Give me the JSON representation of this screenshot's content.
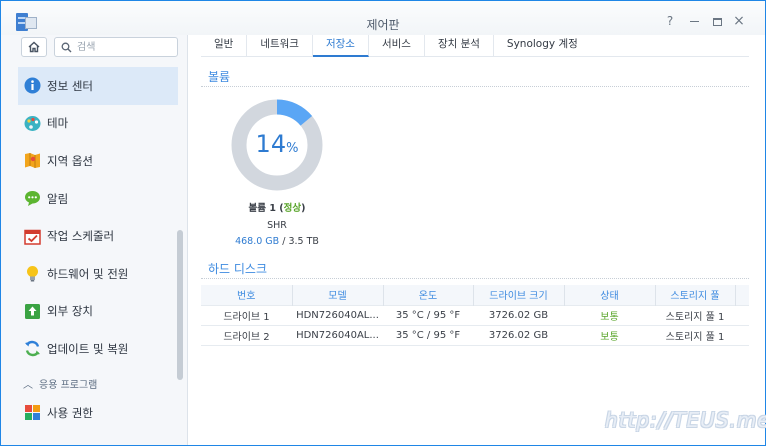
{
  "window": {
    "title": "제어판",
    "help_icon": "question-icon",
    "minimize_icon": "minimize-icon",
    "maximize_icon": "maximize-icon",
    "close_icon": "close-icon"
  },
  "sidebar": {
    "search_placeholder": "검색",
    "items": [
      {
        "label": "정보 센터",
        "icon": "info-icon",
        "active": true
      },
      {
        "label": "테마",
        "icon": "palette-icon"
      },
      {
        "label": "지역 옵션",
        "icon": "map-icon"
      },
      {
        "label": "알림",
        "icon": "chat-bubble-icon"
      },
      {
        "label": "작업 스케줄러",
        "icon": "calendar-icon"
      },
      {
        "label": "하드웨어 및 전원",
        "icon": "lightbulb-icon"
      },
      {
        "label": "외부 장치",
        "icon": "upload-icon"
      },
      {
        "label": "업데이트 및 복원",
        "icon": "refresh-icon"
      }
    ],
    "group_label": "응용 프로그램",
    "group_items": [
      {
        "label": "사용 권한",
        "icon": "grid-icon"
      }
    ]
  },
  "tabs": [
    {
      "label": "일반"
    },
    {
      "label": "네트워크"
    },
    {
      "label": "저장소",
      "active": true
    },
    {
      "label": "서비스"
    },
    {
      "label": "장치 분석"
    },
    {
      "label": "Synology 계정"
    }
  ],
  "volume": {
    "section_title": "볼륨",
    "usage_percent": 14,
    "usage_unit": "%",
    "name": "볼륨 1",
    "status": "정상",
    "raid_type": "SHR",
    "used": "468.0 GB",
    "total": "3.5 TB",
    "colors": {
      "used": "#5aa6f5",
      "free": "#d2d7de"
    }
  },
  "disks": {
    "section_title": "하드 디스크",
    "columns": [
      "번호",
      "모델",
      "온도",
      "드라이브 크기",
      "상태",
      "스토리지 풀"
    ],
    "rows": [
      [
        "드라이브 1",
        "HDN726040AL...",
        "35 °C / 95 °F",
        "3726.02 GB",
        "보통",
        "스토리지 풀 1"
      ],
      [
        "드라이브 2",
        "HDN726040AL...",
        "35 °C / 95 °F",
        "3726.02 GB",
        "보통",
        "스토리지 풀 1"
      ]
    ]
  },
  "watermark": "http://TEUS.me"
}
